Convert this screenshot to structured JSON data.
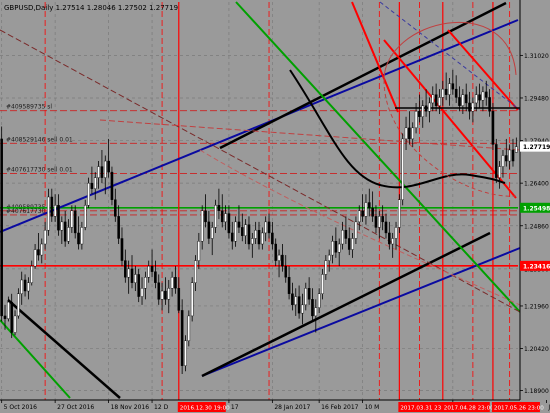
{
  "chart_data": {
    "type": "candlestick",
    "title": "GBPUSD,Daily  1.27514 1.28046 1.27502 1.27719",
    "theme": {
      "background": "#9a9a9a",
      "grid": "#7a7a7a",
      "up": "#ffffff",
      "down": "#000000",
      "wick": "#000000"
    },
    "ylim": [
      1.1856,
      1.3295
    ],
    "y_ticks": [
      "1.31020",
      "1.29480",
      "1.27940",
      "1.26400",
      "1.24860",
      "1.23300",
      "1.21960",
      "1.20420",
      "1.18900"
    ],
    "y_tick_values": [
      1.3102,
      1.2948,
      1.2794,
      1.264,
      1.2486,
      1.233,
      1.2196,
      1.2042,
      1.189
    ],
    "x_ticks": [
      "5 Oct 2016",
      "27 Oct 2016",
      "18 Nov 2016",
      "12 D",
      "17",
      "28 Jan 2017",
      "16 Feb 2017",
      "10 M",
      "17",
      "Jun 2017"
    ],
    "x_tick_index": [
      0,
      16,
      32,
      45,
      68,
      81,
      95,
      108,
      135,
      163
    ],
    "highlight_x_labels": [
      {
        "text": "2016.12.30 19:00",
        "index": 53
      },
      {
        "text": "2017.03.31 23:00",
        "index": 119
      },
      {
        "text": "2017.04.28 23:00",
        "index": 132
      },
      {
        "text": "2017.05.26 23:00",
        "index": 147
      }
    ],
    "price_labels": [
      {
        "text": "1.27719",
        "value": 1.2772,
        "bg": "#ffffff",
        "fg": "#000000"
      },
      {
        "text": "1.25498",
        "value": 1.2551,
        "bg": "#00a000",
        "fg": "#ffffff"
      },
      {
        "text": "1.23416",
        "value": 1.2341,
        "bg": "#ff0000",
        "fg": "#ffffff"
      }
    ],
    "hlines": [
      {
        "label": "#409589735 sl",
        "value": 1.2902,
        "color": "#cc2222",
        "dash": true
      },
      {
        "label": "#408529146 sell 0.01",
        "value": 1.2784,
        "color": "#cc2222",
        "dash": true
      },
      {
        "label": "#407617730 sell 0.01",
        "value": 1.2675,
        "color": "#cc2222",
        "dash": true
      },
      {
        "label": "#409589735 sl",
        "value": 1.254,
        "color": "#cc2222",
        "dash": true
      },
      {
        "label": "#407617730 sl",
        "value": 1.2525,
        "color": "#cc2222",
        "dash": true
      },
      {
        "label": "",
        "value": 1.2551,
        "color": "#00a000",
        "dash": false
      },
      {
        "label": "",
        "value": 1.2341,
        "color": "#ff0000",
        "dash": false
      }
    ],
    "vlines_index": [
      13,
      48,
      80,
      113,
      125,
      141,
      152,
      170
    ],
    "hl_vlines_index": [
      53,
      119,
      132,
      147
    ],
    "candles": [
      [
        1.28,
        1.2845,
        1.214,
        1.216
      ],
      [
        1.216,
        1.22,
        1.211,
        1.215
      ],
      [
        1.215,
        1.223,
        1.214,
        1.221
      ],
      [
        1.221,
        1.224,
        1.208,
        1.21
      ],
      [
        1.21,
        1.218,
        1.209,
        1.216
      ],
      [
        1.216,
        1.226,
        1.215,
        1.224
      ],
      [
        1.224,
        1.232,
        1.22,
        1.229
      ],
      [
        1.229,
        1.231,
        1.223,
        1.225
      ],
      [
        1.225,
        1.23,
        1.222,
        1.228
      ],
      [
        1.228,
        1.236,
        1.227,
        1.234
      ],
      [
        1.234,
        1.242,
        1.233,
        1.24
      ],
      [
        1.24,
        1.246,
        1.236,
        1.238
      ],
      [
        1.238,
        1.244,
        1.235,
        1.242
      ],
      [
        1.242,
        1.25,
        1.24,
        1.247
      ],
      [
        1.247,
        1.262,
        1.245,
        1.259
      ],
      [
        1.259,
        1.262,
        1.25,
        1.252
      ],
      [
        1.252,
        1.26,
        1.25,
        1.256
      ],
      [
        1.256,
        1.26,
        1.245,
        1.247
      ],
      [
        1.247,
        1.252,
        1.242,
        1.25
      ],
      [
        1.25,
        1.254,
        1.241,
        1.243
      ],
      [
        1.243,
        1.251,
        1.242,
        1.248
      ],
      [
        1.248,
        1.256,
        1.246,
        1.254
      ],
      [
        1.254,
        1.256,
        1.244,
        1.246
      ],
      [
        1.246,
        1.252,
        1.24,
        1.242
      ],
      [
        1.242,
        1.25,
        1.24,
        1.248
      ],
      [
        1.248,
        1.258,
        1.247,
        1.256
      ],
      [
        1.256,
        1.266,
        1.255,
        1.264
      ],
      [
        1.264,
        1.27,
        1.26,
        1.262
      ],
      [
        1.262,
        1.268,
        1.258,
        1.266
      ],
      [
        1.266,
        1.272,
        1.262,
        1.27
      ],
      [
        1.27,
        1.276,
        1.264,
        1.266
      ],
      [
        1.266,
        1.274,
        1.26,
        1.272
      ],
      [
        1.272,
        1.28,
        1.266,
        1.268
      ],
      [
        1.268,
        1.27,
        1.256,
        1.258
      ],
      [
        1.258,
        1.262,
        1.25,
        1.252
      ],
      [
        1.252,
        1.256,
        1.242,
        1.244
      ],
      [
        1.244,
        1.248,
        1.234,
        1.236
      ],
      [
        1.236,
        1.24,
        1.228,
        1.23
      ],
      [
        1.23,
        1.236,
        1.224,
        1.233
      ],
      [
        1.233,
        1.238,
        1.226,
        1.228
      ],
      [
        1.228,
        1.234,
        1.225,
        1.231
      ],
      [
        1.231,
        1.233,
        1.221,
        1.223
      ],
      [
        1.223,
        1.23,
        1.22,
        1.226
      ],
      [
        1.226,
        1.232,
        1.222,
        1.23
      ],
      [
        1.23,
        1.236,
        1.228,
        1.234
      ],
      [
        1.234,
        1.24,
        1.23,
        1.232
      ],
      [
        1.232,
        1.236,
        1.226,
        1.228
      ],
      [
        1.228,
        1.231,
        1.22,
        1.222
      ],
      [
        1.222,
        1.228,
        1.218,
        1.225
      ],
      [
        1.225,
        1.23,
        1.22,
        1.222
      ],
      [
        1.222,
        1.229,
        1.217,
        1.226
      ],
      [
        1.226,
        1.232,
        1.223,
        1.23
      ],
      [
        1.23,
        1.234,
        1.224,
        1.226
      ],
      [
        1.226,
        1.23,
        1.217,
        1.218
      ],
      [
        1.218,
        1.222,
        1.195,
        1.198
      ],
      [
        1.198,
        1.209,
        1.196,
        1.207
      ],
      [
        1.207,
        1.218,
        1.205,
        1.216
      ],
      [
        1.216,
        1.23,
        1.214,
        1.228
      ],
      [
        1.228,
        1.238,
        1.225,
        1.236
      ],
      [
        1.236,
        1.246,
        1.233,
        1.243
      ],
      [
        1.243,
        1.256,
        1.24,
        1.254
      ],
      [
        1.254,
        1.26,
        1.248,
        1.25
      ],
      [
        1.25,
        1.254,
        1.242,
        1.244
      ],
      [
        1.244,
        1.25,
        1.238,
        1.248
      ],
      [
        1.248,
        1.258,
        1.246,
        1.256
      ],
      [
        1.256,
        1.262,
        1.251,
        1.254
      ],
      [
        1.254,
        1.26,
        1.248,
        1.25
      ],
      [
        1.25,
        1.256,
        1.247,
        1.253
      ],
      [
        1.253,
        1.256,
        1.244,
        1.246
      ],
      [
        1.246,
        1.25,
        1.24,
        1.243
      ],
      [
        1.243,
        1.252,
        1.241,
        1.25
      ],
      [
        1.25,
        1.256,
        1.246,
        1.248
      ],
      [
        1.248,
        1.253,
        1.243,
        1.245
      ],
      [
        1.245,
        1.251,
        1.242,
        1.249
      ],
      [
        1.249,
        1.252,
        1.24,
        1.242
      ],
      [
        1.242,
        1.246,
        1.237,
        1.244
      ],
      [
        1.244,
        1.25,
        1.242,
        1.247
      ],
      [
        1.247,
        1.25,
        1.24,
        1.242
      ],
      [
        1.242,
        1.248,
        1.24,
        1.246
      ],
      [
        1.246,
        1.252,
        1.243,
        1.25
      ],
      [
        1.25,
        1.253,
        1.244,
        1.246
      ],
      [
        1.246,
        1.25,
        1.24,
        1.242
      ],
      [
        1.242,
        1.244,
        1.234,
        1.236
      ],
      [
        1.236,
        1.24,
        1.23,
        1.238
      ],
      [
        1.238,
        1.242,
        1.232,
        1.234
      ],
      [
        1.234,
        1.238,
        1.228,
        1.23
      ],
      [
        1.23,
        1.234,
        1.222,
        1.224
      ],
      [
        1.224,
        1.228,
        1.218,
        1.22
      ],
      [
        1.22,
        1.226,
        1.216,
        1.223
      ],
      [
        1.223,
        1.227,
        1.215,
        1.217
      ],
      [
        1.217,
        1.224,
        1.213,
        1.22
      ],
      [
        1.22,
        1.228,
        1.218,
        1.226
      ],
      [
        1.226,
        1.23,
        1.22,
        1.222
      ],
      [
        1.222,
        1.226,
        1.214,
        1.216
      ],
      [
        1.216,
        1.222,
        1.21,
        1.219
      ],
      [
        1.219,
        1.226,
        1.217,
        1.224
      ],
      [
        1.224,
        1.233,
        1.222,
        1.231
      ],
      [
        1.231,
        1.238,
        1.229,
        1.236
      ],
      [
        1.236,
        1.24,
        1.232,
        1.238
      ],
      [
        1.238,
        1.245,
        1.235,
        1.243
      ],
      [
        1.243,
        1.248,
        1.237,
        1.239
      ],
      [
        1.239,
        1.244,
        1.234,
        1.242
      ],
      [
        1.242,
        1.25,
        1.24,
        1.247
      ],
      [
        1.247,
        1.252,
        1.242,
        1.244
      ],
      [
        1.244,
        1.248,
        1.238,
        1.24
      ],
      [
        1.24,
        1.246,
        1.237,
        1.244
      ],
      [
        1.244,
        1.252,
        1.242,
        1.25
      ],
      [
        1.25,
        1.256,
        1.247,
        1.254
      ],
      [
        1.254,
        1.26,
        1.25,
        1.252
      ],
      [
        1.252,
        1.26,
        1.249,
        1.257
      ],
      [
        1.257,
        1.262,
        1.252,
        1.255
      ],
      [
        1.255,
        1.261,
        1.25,
        1.252
      ],
      [
        1.252,
        1.256,
        1.246,
        1.248
      ],
      [
        1.248,
        1.254,
        1.244,
        1.252
      ],
      [
        1.252,
        1.256,
        1.247,
        1.25
      ],
      [
        1.25,
        1.253,
        1.244,
        1.246
      ],
      [
        1.246,
        1.25,
        1.24,
        1.242
      ],
      [
        1.242,
        1.246,
        1.237,
        1.244
      ],
      [
        1.244,
        1.25,
        1.24,
        1.248
      ],
      [
        1.248,
        1.26,
        1.246,
        1.258
      ],
      [
        1.258,
        1.282,
        1.256,
        1.28
      ],
      [
        1.28,
        1.288,
        1.276,
        1.284
      ],
      [
        1.284,
        1.29,
        1.278,
        1.28
      ],
      [
        1.28,
        1.286,
        1.277,
        1.284
      ],
      [
        1.284,
        1.293,
        1.282,
        1.29
      ],
      [
        1.29,
        1.296,
        1.286,
        1.288
      ],
      [
        1.288,
        1.294,
        1.284,
        1.292
      ],
      [
        1.292,
        1.298,
        1.288,
        1.29
      ],
      [
        1.29,
        1.295,
        1.286,
        1.293
      ],
      [
        1.293,
        1.299,
        1.29,
        1.296
      ],
      [
        1.296,
        1.3,
        1.29,
        1.292
      ],
      [
        1.292,
        1.298,
        1.289,
        1.295
      ],
      [
        1.295,
        1.301,
        1.292,
        1.298
      ],
      [
        1.298,
        1.304,
        1.294,
        1.296
      ],
      [
        1.296,
        1.302,
        1.292,
        1.3
      ],
      [
        1.3,
        1.305,
        1.296,
        1.298
      ],
      [
        1.298,
        1.303,
        1.293,
        1.295
      ],
      [
        1.295,
        1.299,
        1.29,
        1.292
      ],
      [
        1.292,
        1.298,
        1.289,
        1.296
      ],
      [
        1.296,
        1.3,
        1.29,
        1.293
      ],
      [
        1.293,
        1.297,
        1.287,
        1.29
      ],
      [
        1.29,
        1.295,
        1.286,
        1.293
      ],
      [
        1.293,
        1.299,
        1.29,
        1.296
      ],
      [
        1.296,
        1.3,
        1.291,
        1.294
      ],
      [
        1.294,
        1.299,
        1.29,
        1.297
      ],
      [
        1.297,
        1.301,
        1.292,
        1.295
      ],
      [
        1.295,
        1.298,
        1.288,
        1.29
      ],
      [
        1.29,
        1.293,
        1.276,
        1.278
      ],
      [
        1.278,
        1.28,
        1.264,
        1.266
      ],
      [
        1.266,
        1.272,
        1.262,
        1.27
      ],
      [
        1.27,
        1.276,
        1.266,
        1.274
      ],
      [
        1.274,
        1.28,
        1.27,
        1.272
      ],
      [
        1.272,
        1.278,
        1.269,
        1.276
      ],
      [
        1.276,
        1.28,
        1.27,
        1.272
      ],
      [
        1.2751,
        1.2805,
        1.275,
        1.2772
      ]
    ]
  }
}
